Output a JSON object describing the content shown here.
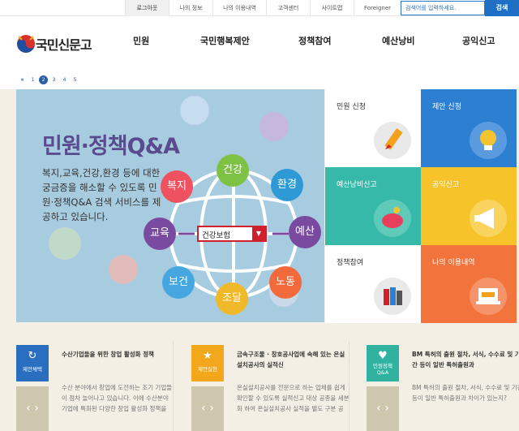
{
  "topbar": {
    "links": [
      "로그아웃",
      "나의 정보",
      "나의 이용내역",
      "고객센터",
      "사이트맵",
      "Foreigner"
    ],
    "search_placeholder": "검색어를 입력하세요.",
    "search_button": "검색"
  },
  "header": {
    "logo_text": "국민신문고",
    "nav": [
      "민원",
      "국민행복제안",
      "정책참여",
      "예산낭비",
      "공익신고"
    ]
  },
  "pager": {
    "items": [
      "1",
      "2",
      "3",
      "4",
      "5"
    ],
    "active": "2"
  },
  "hero": {
    "title": "민원·정책Q&A",
    "description": "복지,교육,건강,환경 등에 대한 궁금증을 해소할 수 있도록 민원·정책Q&A 검색 서비스를 제공하고 있습니다.",
    "globe_topics": [
      "건강",
      "환경",
      "복지",
      "교육",
      "예산",
      "보건",
      "조달",
      "노동"
    ],
    "select_value": "건강보험"
  },
  "tiles": [
    {
      "label": "민원 신청",
      "bg": "#ffffff",
      "fg": "#333333"
    },
    {
      "label": "제안 신청",
      "bg": "#2d7fd2",
      "fg": "#ffffff"
    },
    {
      "label": "예산낭비신고",
      "bg": "#37b9a9",
      "fg": "#ffffff"
    },
    {
      "label": "공익신고",
      "bg": "#f6c42a",
      "fg": "#ffffff"
    },
    {
      "label": "정책참여",
      "bg": "#ffffff",
      "fg": "#333333"
    },
    {
      "label": "나의 이용내역",
      "bg": "#f2733c",
      "fg": "#ffffff"
    }
  ],
  "cards": [
    {
      "badge": "제안채택",
      "symbol": "↻",
      "color": "#2a6ec0",
      "title": "수산기업들을 위한 창업 활성화 정책",
      "body": "수산 분야에서 창업에 도전하는 조기 기업들이 점차 늘어나고 있습니다. 이에 수산분야 기업에 특화된 다양한 창업 활성화 정책을"
    },
    {
      "badge": "제안실현",
      "symbol": "★",
      "color": "#f2a71d",
      "title": "금속구조물 · 창호공사업에 속해 있는 온실설치공사의 실적신",
      "body": "온실설치공사를 전문으로 하는 업체를 쉽게 확인할 수 있도록 실적신고 대상 공종을 세분화 하여 온실설치공사 실적을 별도 구분 공"
    },
    {
      "badge": "민원정책 Q&A",
      "symbol": "♥",
      "color": "#2fb3a0",
      "title": "BM 특허의 출원 절차, 서식, 수수료 및 기간 등이 일반 특허출원과",
      "body": "BM 특허의 출원 절차, 서식, 수수료 및 기간 등이 일반 특허출원과 차이가 있는지?"
    }
  ],
  "arrows": "‹ ›"
}
